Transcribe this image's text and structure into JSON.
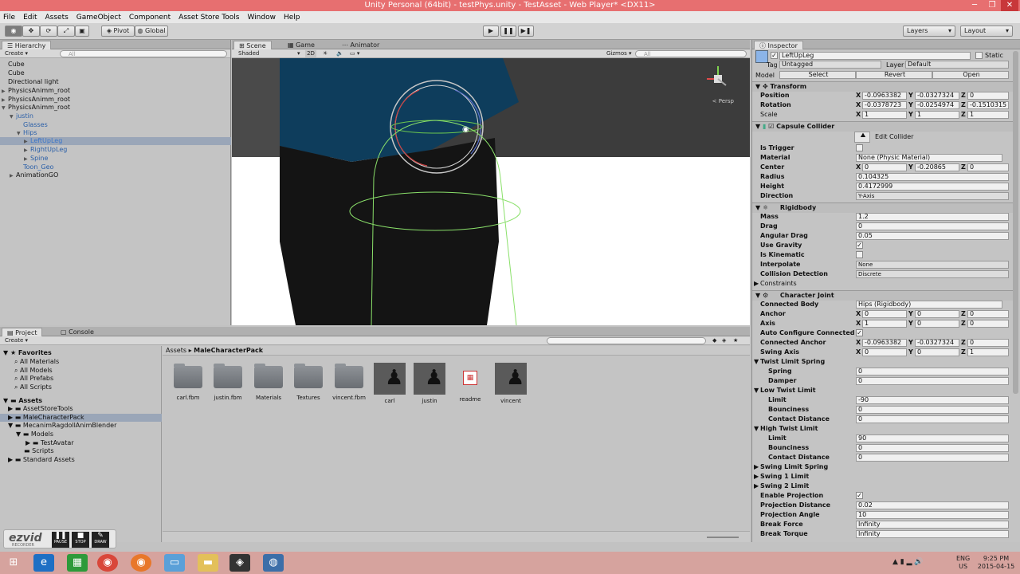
{
  "window": {
    "title": "Unity Personal (64bit) - testPhys.unity - TestAsset - Web Player* <DX11>"
  },
  "menu": [
    "File",
    "Edit",
    "Assets",
    "GameObject",
    "Component",
    "Asset Store Tools",
    "Window",
    "Help"
  ],
  "toolbar": {
    "pivot": "Pivot",
    "global": "Global",
    "layers": "Layers",
    "layout": "Layout"
  },
  "hierarchy": {
    "tab": "Hierarchy",
    "create": "Create",
    "search_placeholder": "All",
    "items": [
      "Cube",
      "Cube",
      "Directional light",
      "PhysicsAnimm_root",
      "PhysicsAnimm_root",
      "PhysicsAnimm_root",
      "justin",
      "Glasses",
      "Hips",
      "LeftUpLeg",
      "RightUpLeg",
      "Spine",
      "Toon_Geo",
      "AnimationGO"
    ]
  },
  "scene": {
    "tabs": [
      "Scene",
      "Game",
      "Animator"
    ],
    "shading": "Shaded",
    "mode_2d": "2D",
    "gizmos": "Gizmos",
    "search_placeholder": "All",
    "persp": "Persp"
  },
  "project": {
    "tabs": [
      "Project",
      "Console"
    ],
    "create": "Create",
    "breadcrumb": [
      "Assets",
      "MaleCharacterPack"
    ],
    "favorites_label": "Favorites",
    "favorites": [
      "All Materials",
      "All Models",
      "All Prefabs",
      "All Scripts"
    ],
    "assets_label": "Assets",
    "tree": [
      "AssetStoreTools",
      "MaleCharacterPack",
      "MecanimRagdollAnimBlender",
      "Models",
      "TestAvatar",
      "Scripts",
      "Standard Assets"
    ],
    "items": [
      "carl.fbm",
      "justin.fbm",
      "Materials",
      "Textures",
      "vincent.fbm",
      "carl",
      "justin",
      "readme",
      "vincent"
    ]
  },
  "inspector": {
    "tab": "Inspector",
    "object_name": "LeftUpLeg",
    "static": "Static",
    "tag_label": "Tag",
    "tag": "Untagged",
    "layer_label": "Layer",
    "layer": "Default",
    "model_label": "Model",
    "select": "Select",
    "revert": "Revert",
    "open": "Open",
    "transform": {
      "title": "Transform",
      "position": {
        "label": "Position",
        "x": "-0.0963382",
        "y": "-0.0327324",
        "z": "0"
      },
      "rotation": {
        "label": "Rotation",
        "x": "-0.0378723",
        "y": "-0.0254974",
        "z": "-0.1510315"
      },
      "scale": {
        "label": "Scale",
        "x": "1",
        "y": "1",
        "z": "1"
      }
    },
    "capsule": {
      "title": "Capsule Collider",
      "edit": "Edit Collider",
      "is_trigger": "Is Trigger",
      "material_label": "Material",
      "material": "None (Physic Material)",
      "center_label": "Center",
      "cx": "0",
      "cy": "-0.20865",
      "cz": "0",
      "radius_label": "Radius",
      "radius": "0.104325",
      "height_label": "Height",
      "height": "0.4172999",
      "direction_label": "Direction",
      "direction": "Y-Axis"
    },
    "rigidbody": {
      "title": "Rigidbody",
      "mass_label": "Mass",
      "mass": "1.2",
      "drag_label": "Drag",
      "drag": "0",
      "angular_label": "Angular Drag",
      "angular": "0.05",
      "gravity_label": "Use Gravity",
      "kinematic_label": "Is Kinematic",
      "interpolate_label": "Interpolate",
      "interpolate": "None",
      "collision_label": "Collision Detection",
      "collision": "Discrete",
      "constraints": "Constraints"
    },
    "joint": {
      "title": "Character Joint",
      "connected_label": "Connected Body",
      "connected": "Hips (Rigidbody)",
      "anchor_label": "Anchor",
      "ax": "0",
      "ay": "0",
      "az": "0",
      "axis_label": "Axis",
      "axx": "1",
      "axy": "0",
      "axz": "0",
      "auto_label": "Auto Configure Connected A",
      "canchor_label": "Connected Anchor",
      "cax": "-0.0963382",
      "cay": "-0.0327324",
      "caz": "0",
      "swingaxis_label": "Swing Axis",
      "sx": "0",
      "sy": "0",
      "sz": "1",
      "twist_spring": "Twist Limit Spring",
      "spring_label": "Spring",
      "spring": "0",
      "damper_label": "Damper",
      "damper": "0",
      "low_twist": "Low Twist Limit",
      "limit_label": "Limit",
      "low_limit": "-90",
      "bounciness_label": "Bounciness",
      "low_bounce": "0",
      "contact_label": "Contact Distance",
      "low_contact": "0",
      "high_twist": "High Twist Limit",
      "high_limit": "90",
      "high_bounce": "0",
      "high_contact": "0",
      "swing_spring": "Swing Limit Spring",
      "swing1": "Swing 1 Limit",
      "swing2": "Swing 2 Limit",
      "enable_proj": "Enable Projection",
      "proj_dist_label": "Projection Distance",
      "proj_dist": "0.02",
      "proj_angle_label": "Projection Angle",
      "proj_angle": "10",
      "break_force_label": "Break Force",
      "break_force": "Infinity",
      "break_torque_label": "Break Torque",
      "break_torque": "Infinity"
    }
  },
  "taskbar": {
    "lang": "ENG",
    "region": "US",
    "time": "9:25 PM",
    "date": "2015-04-15"
  },
  "ezvid": {
    "brand": "ezvid",
    "sub": "RECORDER",
    "pause": "PAUSE",
    "stop": "STOP",
    "draw": "DRAW"
  }
}
